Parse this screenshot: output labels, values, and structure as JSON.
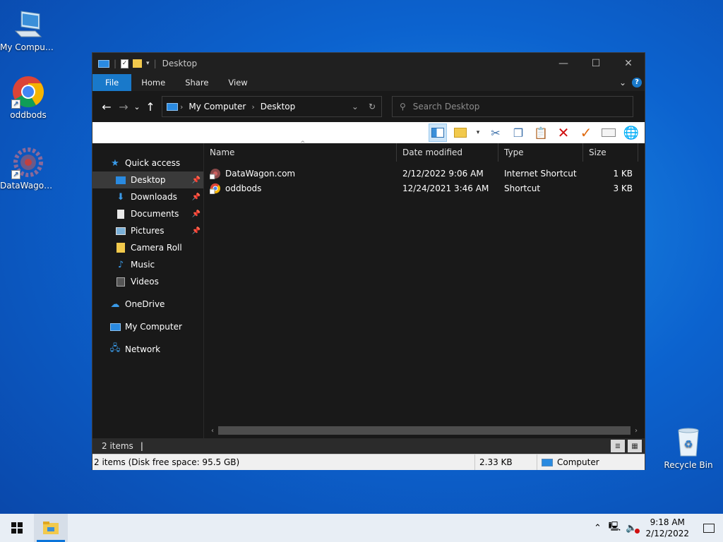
{
  "desktop": {
    "icons": [
      {
        "label": "My Computer"
      },
      {
        "label": "oddbods"
      },
      {
        "label": "DataWagon..."
      },
      {
        "label": "Recycle Bin"
      }
    ]
  },
  "window": {
    "title": "Desktop",
    "ribbon_tabs": [
      "File",
      "Home",
      "Share",
      "View"
    ],
    "help_label": "?",
    "address": {
      "segments": [
        "My Computer",
        "Desktop"
      ]
    },
    "search": {
      "placeholder": "Search Desktop"
    },
    "nav": {
      "quick_access": "Quick access",
      "items": [
        {
          "label": "Desktop",
          "pinned": true,
          "selected": true
        },
        {
          "label": "Downloads",
          "pinned": true
        },
        {
          "label": "Documents",
          "pinned": true
        },
        {
          "label": "Pictures",
          "pinned": true
        },
        {
          "label": "Camera Roll"
        },
        {
          "label": "Music"
        },
        {
          "label": "Videos"
        }
      ],
      "onedrive": "OneDrive",
      "my_computer": "My Computer",
      "network": "Network"
    },
    "columns": {
      "name": "Name",
      "date": "Date modified",
      "type": "Type",
      "size": "Size"
    },
    "files": [
      {
        "name": "DataWagon.com",
        "date": "2/12/2022 9:06 AM",
        "type": "Internet Shortcut",
        "size": "1 KB"
      },
      {
        "name": "oddbods",
        "date": "12/24/2021 3:46 AM",
        "type": "Shortcut",
        "size": "3 KB"
      }
    ],
    "status": {
      "count": "2 items",
      "detail": "2 items (Disk free space: 95.5 GB)",
      "size": "2.33 KB",
      "location": "Computer"
    }
  },
  "taskbar": {
    "time": "9:18 AM",
    "date": "2/12/2022"
  },
  "colors": {
    "accent": "#1979ca",
    "window_bg": "#191919",
    "desktop": "#0c63cf"
  }
}
